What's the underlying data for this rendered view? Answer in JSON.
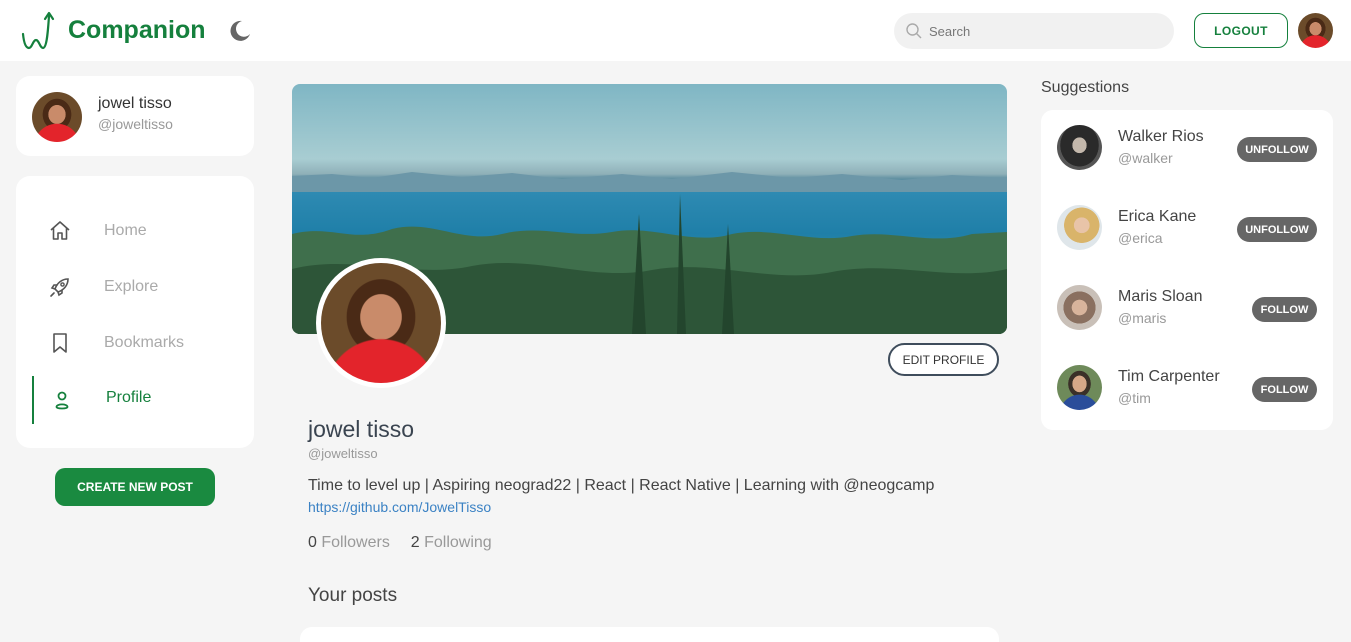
{
  "header": {
    "brand": "Companion",
    "search_placeholder": "Search",
    "logout_label": "LOGOUT"
  },
  "user": {
    "name": "jowel tisso",
    "handle": "@joweltisso"
  },
  "nav": {
    "items": [
      {
        "label": "Home",
        "icon": "home-icon",
        "active": false
      },
      {
        "label": "Explore",
        "icon": "rocket-icon",
        "active": false
      },
      {
        "label": "Bookmarks",
        "icon": "bookmark-icon",
        "active": false
      },
      {
        "label": "Profile",
        "icon": "user-icon",
        "active": true
      }
    ]
  },
  "create_post_label": "CREATE NEW POST",
  "profile": {
    "name": "jowel tisso",
    "handle": "@joweltisso",
    "bio": "Time to level up | Aspiring neograd22 | React | React Native | Learning with @neogcamp",
    "link": "https://github.com/JowelTisso",
    "followers_count": "0",
    "followers_label": "Followers",
    "following_count": "2",
    "following_label": "Following",
    "edit_label": "EDIT PROFILE",
    "posts_title": "Your posts"
  },
  "suggestions": {
    "title": "Suggestions",
    "users": [
      {
        "name": "Walker Rios",
        "handle": "@walker",
        "action": "UNFOLLOW"
      },
      {
        "name": "Erica Kane",
        "handle": "@erica",
        "action": "UNFOLLOW"
      },
      {
        "name": "Maris Sloan",
        "handle": "@maris",
        "action": "FOLLOW"
      },
      {
        "name": "Tim Carpenter",
        "handle": "@tim",
        "action": "FOLLOW"
      }
    ]
  },
  "colors": {
    "accent": "#15803d",
    "button_gray": "#666666",
    "background": "#f5f5f5"
  }
}
